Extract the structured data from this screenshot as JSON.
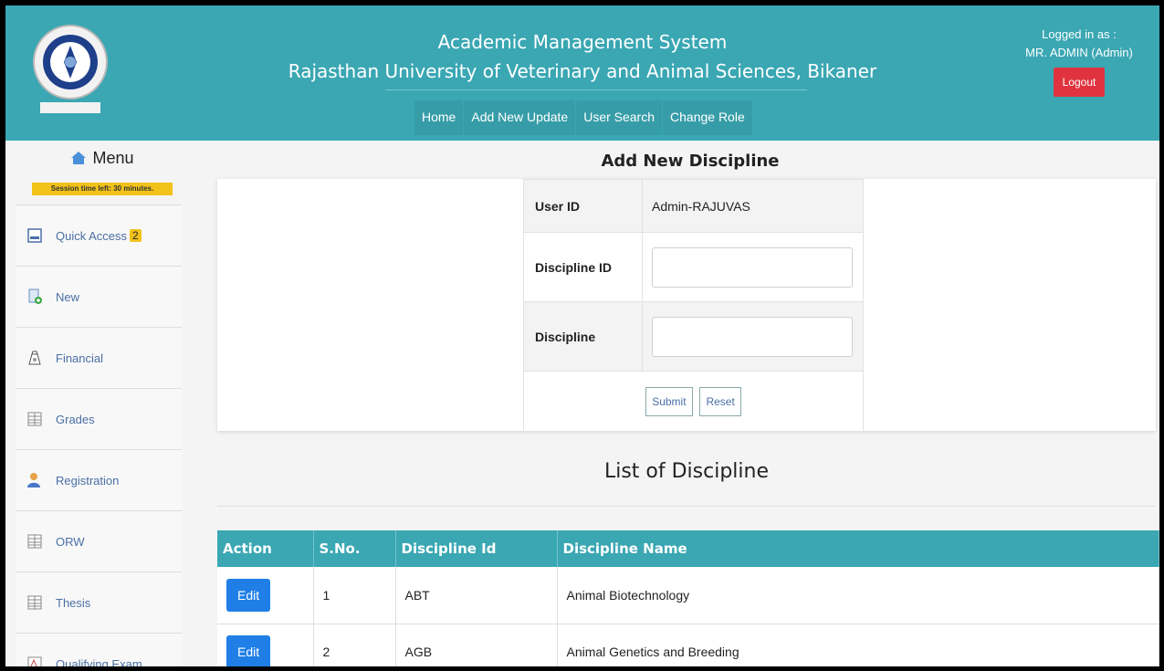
{
  "header": {
    "title": "Academic Management System",
    "subtitle": "Rajasthan University of Veterinary and Animal Sciences, Bikaner",
    "nav": [
      "Home",
      "Add New Update",
      "User Search",
      "Change Role"
    ],
    "logged_in_label": "Logged in as :",
    "user": "MR. ADMIN (Admin)",
    "logout": "Logout",
    "accent_color": "#3aa7b3",
    "logout_color": "#e0333f"
  },
  "sidebar": {
    "title": "Menu",
    "session": "Session time left: 30 minutes.",
    "items": [
      {
        "label": "Quick Access",
        "badge": "2",
        "icon": "quick-access-icon"
      },
      {
        "label": "New",
        "icon": "new-document-icon"
      },
      {
        "label": "Financial",
        "icon": "financial-icon"
      },
      {
        "label": "Grades",
        "icon": "grid-icon"
      },
      {
        "label": "Registration",
        "icon": "user-icon"
      },
      {
        "label": "ORW",
        "icon": "grid-icon"
      },
      {
        "label": "Thesis",
        "icon": "grid-icon"
      },
      {
        "label": "Qualifying Exam",
        "icon": "exam-icon"
      }
    ]
  },
  "form": {
    "heading": "Add New Discipline",
    "user_id_label": "User ID",
    "user_id_value": "Admin-RAJUVAS",
    "discipline_id_label": "Discipline ID",
    "discipline_id_value": "",
    "discipline_label": "Discipline",
    "discipline_value": "",
    "submit": "Submit",
    "reset": "Reset"
  },
  "list": {
    "heading": "List of Discipline",
    "columns": [
      "Action",
      "S.No.",
      "Discipline Id",
      "Discipline Name"
    ],
    "rows": [
      {
        "action": "Edit",
        "sno": "1",
        "id": "ABT",
        "name": "Animal Biotechnology"
      },
      {
        "action": "Edit",
        "sno": "2",
        "id": "AGB",
        "name": "Animal Genetics and Breeding"
      }
    ]
  }
}
